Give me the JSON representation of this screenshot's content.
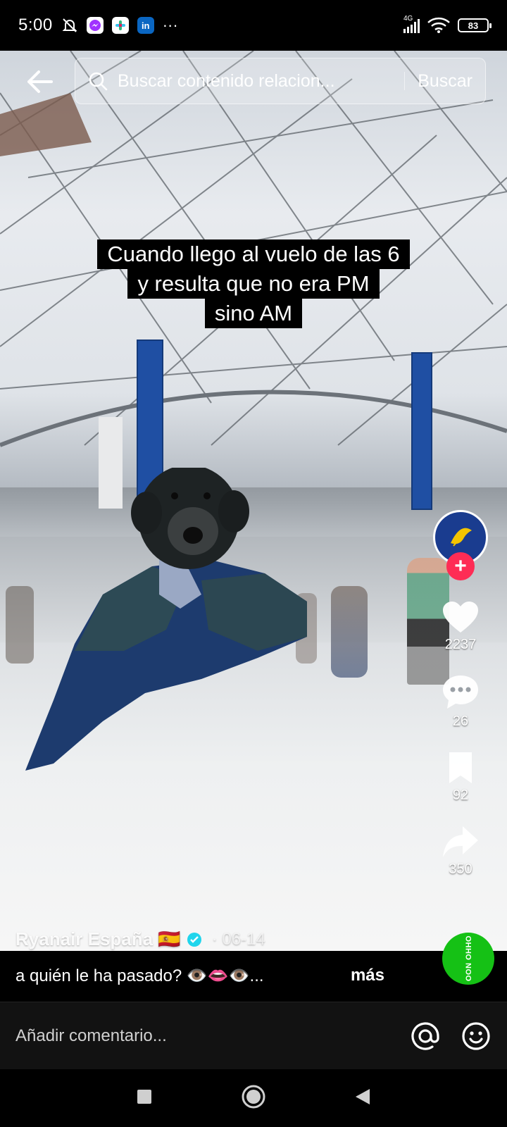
{
  "status_bar": {
    "time": "5:00",
    "network": "4G",
    "battery": "83",
    "more": "···"
  },
  "search": {
    "placeholder": "Buscar contenido relacion...",
    "button_label": "Buscar"
  },
  "caption": {
    "lines": [
      "Cuando llego al vuelo de las 6",
      "y resulta que no era PM",
      "sino AM"
    ]
  },
  "rail": {
    "likes": "2237",
    "comments": "26",
    "saves": "92",
    "shares": "350",
    "follow_symbol": "+"
  },
  "post": {
    "author": "Ryanair España 🇪🇸",
    "date": "· 06-14",
    "description": "a quién le ha pasado? 👁️👄👁️...",
    "more_label": "más",
    "badge_label": "OHHO NOO"
  },
  "comment": {
    "placeholder": "Añadir comentario..."
  },
  "colors": {
    "accent": "#fe2c55",
    "ryanair_blue": "#1a3c8f",
    "badge_green": "#15c115"
  }
}
